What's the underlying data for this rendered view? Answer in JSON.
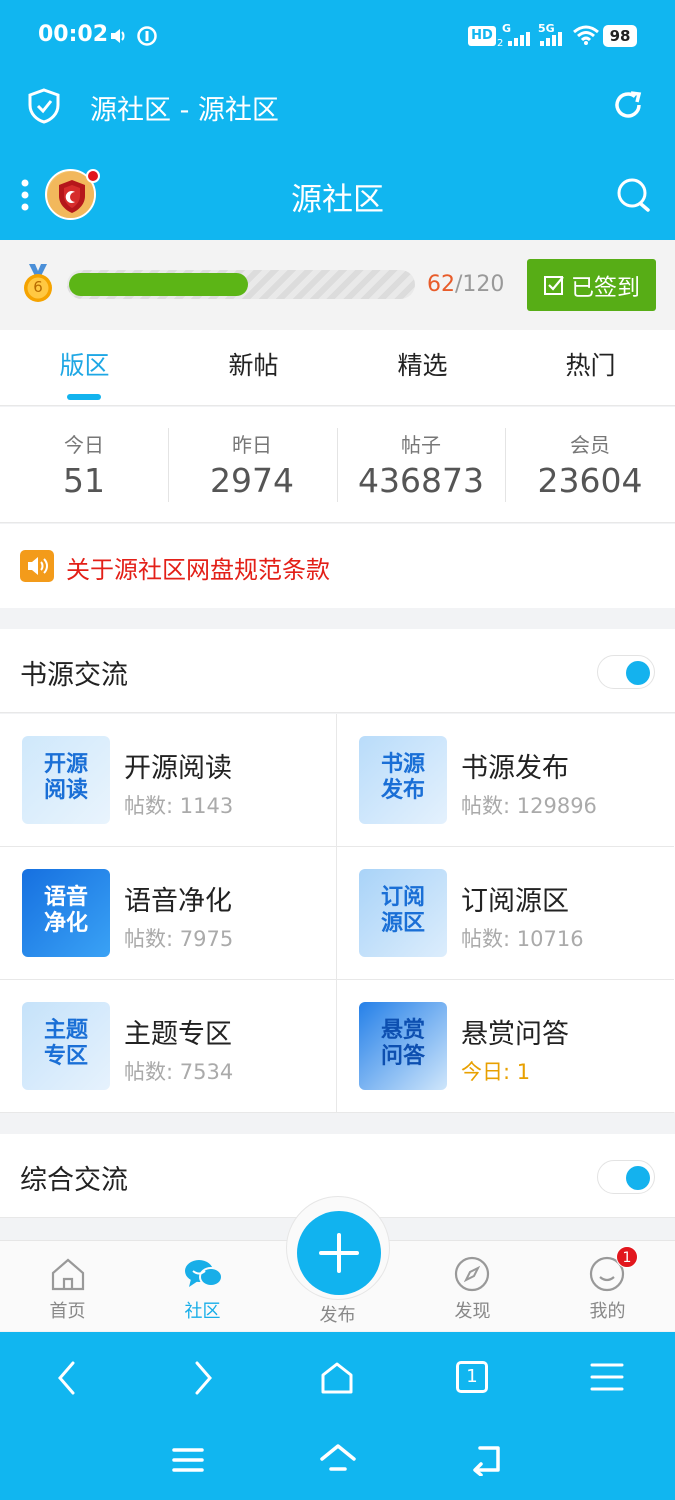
{
  "status_bar": {
    "time": "00:02",
    "network_hd": "HD",
    "network_g": "G",
    "network_5g": "5G",
    "battery": "98"
  },
  "browser": {
    "title": "源社区 - 源社区"
  },
  "app_header": {
    "title": "源社区"
  },
  "level": {
    "badge": "6",
    "current": "62",
    "total": "/120",
    "progress_fraction": 0.52,
    "sign_label": "已签到"
  },
  "tabs": [
    {
      "label": "版区",
      "active": true
    },
    {
      "label": "新帖",
      "active": false
    },
    {
      "label": "精选",
      "active": false
    },
    {
      "label": "热门",
      "active": false
    }
  ],
  "stats": [
    {
      "label": "今日",
      "value": "51"
    },
    {
      "label": "昨日",
      "value": "2974"
    },
    {
      "label": "帖子",
      "value": "436873"
    },
    {
      "label": "会员",
      "value": "23604"
    }
  ],
  "notice": {
    "text": "关于源社区网盘规范条款"
  },
  "sections": [
    {
      "title": "书源交流",
      "toggle_on": true
    },
    {
      "title": "综合交流",
      "toggle_on": true
    }
  ],
  "forums": [
    {
      "name": "开源阅读",
      "count": "帖数: 1143",
      "icon_text": [
        "开源",
        "阅读"
      ]
    },
    {
      "name": "书源发布",
      "count": "帖数: 129896",
      "icon_text": [
        "书源",
        "发布"
      ]
    },
    {
      "name": "语音净化",
      "count": "帖数: 7975",
      "icon_text": [
        "语音",
        "净化"
      ]
    },
    {
      "name": "订阅源区",
      "count": "帖数: 10716",
      "icon_text": [
        "订阅",
        "源区"
      ]
    },
    {
      "name": "主题专区",
      "count": "帖数: 7534",
      "icon_text": [
        "主题",
        "专区"
      ]
    },
    {
      "name": "悬赏问答",
      "count": "今日: 1",
      "icon_text": [
        "悬赏",
        "问答"
      ]
    }
  ],
  "bottom_nav": [
    {
      "label": "首页",
      "icon": "home-icon"
    },
    {
      "label": "社区",
      "icon": "community-icon",
      "active": true
    },
    {
      "label": "发布",
      "icon": "plus-icon"
    },
    {
      "label": "发现",
      "icon": "compass-icon"
    },
    {
      "label": "我的",
      "icon": "profile-icon",
      "badge": "1"
    }
  ],
  "browser_bar": {
    "tab_count": "1"
  },
  "colors": {
    "primary": "#11b6f0",
    "sign_green": "#57ad16",
    "notice_red": "#e32018",
    "accent_orange": "#e8a000"
  }
}
